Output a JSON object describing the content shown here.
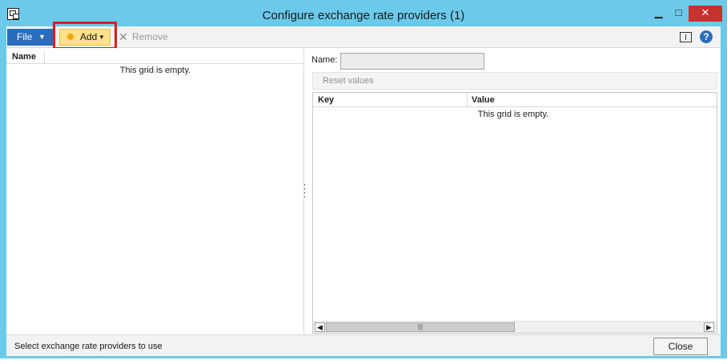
{
  "window": {
    "title": "Configure exchange rate providers (1)",
    "minimize_glyph": "▁",
    "maximize_glyph": "□",
    "close_glyph": "✕"
  },
  "toolbar": {
    "file_label": "File",
    "add_label": "Add",
    "remove_label": "Remove"
  },
  "left_grid": {
    "column_name": "Name",
    "empty_text": "This grid is empty."
  },
  "details": {
    "name_label": "Name:",
    "name_value": "",
    "reset_label": "Reset values",
    "column_key": "Key",
    "column_value": "Value",
    "empty_text": "This grid is empty."
  },
  "status": {
    "text": "Select exchange rate providers to use",
    "close_label": "Close"
  },
  "colors": {
    "title_bar": "#6bc9ea",
    "file_button": "#2b6dbd",
    "add_button": "#fde28a",
    "highlight_box": "#e11a1a",
    "window_close": "#c7312e"
  },
  "icons": {
    "app": "app-window-icon",
    "add": "sun-new-icon",
    "remove": "x-remove-icon",
    "layout": "layout-icon",
    "help": "help-icon"
  }
}
